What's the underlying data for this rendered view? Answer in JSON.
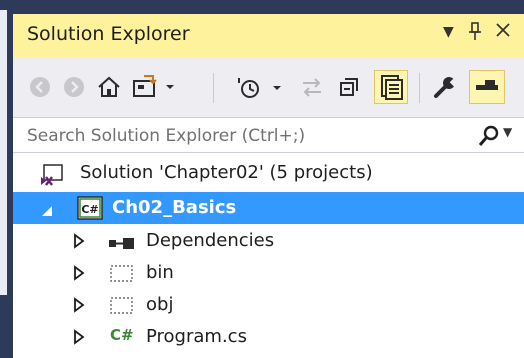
{
  "panel": {
    "title": "Solution Explorer",
    "pin_glyph": "▾",
    "dock_glyph": "ꟷ",
    "close_glyph": "✕"
  },
  "toolbar": {
    "icons": [
      "back-icon",
      "forward-icon",
      "home-icon",
      "switch-views-icon",
      "pending-changes-icon",
      "sync-icon",
      "collapse-all-icon",
      "show-all-files-icon",
      "properties-icon",
      "preview-icon"
    ]
  },
  "search": {
    "placeholder": "Search Solution Explorer (Ctrl+;)",
    "value": ""
  },
  "tree": {
    "solution_label": "Solution 'Chapter02' (5 projects)",
    "project_label": "Ch02_Basics",
    "project_badge": "C#",
    "items": [
      {
        "label": "Dependencies",
        "icon": "dependencies-icon"
      },
      {
        "label": "bin",
        "icon": "folder-icon"
      },
      {
        "label": "obj",
        "icon": "folder-icon"
      },
      {
        "label": "Program.cs",
        "icon": "csharp-file-icon",
        "badge": "C#"
      }
    ]
  },
  "colors": {
    "title_bar": "#fff29d",
    "selection": "#3399ff",
    "frame": "#2d3a5a",
    "toolbar": "#eeeef2"
  }
}
